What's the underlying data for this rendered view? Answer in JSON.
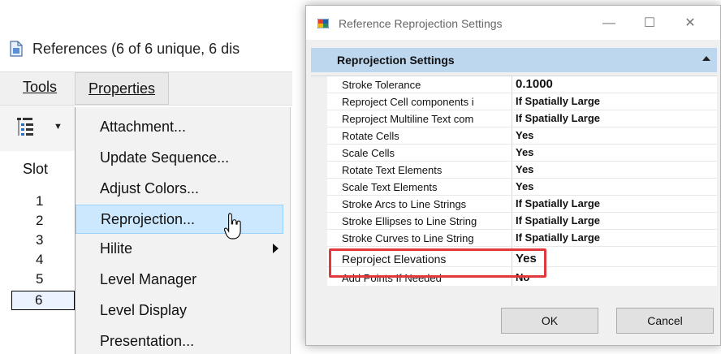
{
  "left_window": {
    "title": "References (6 of 6 unique, 6 dis",
    "menubar": {
      "tools_label": "Tools",
      "properties_label": "Properties"
    },
    "slot": {
      "header": "Slot",
      "rows": [
        "1",
        "2",
        "3",
        "4",
        "5",
        "6"
      ],
      "selected": "6"
    },
    "properties_menu": {
      "items": [
        {
          "label": "Attachment..."
        },
        {
          "label": "Update Sequence..."
        },
        {
          "label": "Adjust Colors..."
        },
        {
          "label": "Reprojection...",
          "highlighted": true
        },
        {
          "label": "Hilite",
          "has_submenu": true
        },
        {
          "label": "Level Manager"
        },
        {
          "label": "Level Display"
        },
        {
          "label": "Presentation..."
        }
      ]
    }
  },
  "dialog": {
    "title": "Reference Reprojection Settings",
    "window_buttons": {
      "minimize": "—",
      "maximize": "☐",
      "close": "✕"
    },
    "section_title": "Reprojection Settings",
    "properties": [
      {
        "key": "Stroke Tolerance",
        "value": "0.1000"
      },
      {
        "key": "Reproject Cell components i",
        "value": "If Spatially Large"
      },
      {
        "key": "Reproject Multiline Text com",
        "value": "If Spatially Large"
      },
      {
        "key": "Rotate Cells",
        "value": "Yes"
      },
      {
        "key": "Scale Cells",
        "value": "Yes"
      },
      {
        "key": "Rotate Text Elements",
        "value": "Yes"
      },
      {
        "key": "Scale Text Elements",
        "value": "Yes"
      },
      {
        "key": "Stroke Arcs to Line Strings",
        "value": "If Spatially Large"
      },
      {
        "key": "Stroke Ellipses to Line String",
        "value": "If Spatially Large"
      },
      {
        "key": "Stroke Curves to Line String",
        "value": "If Spatially Large"
      },
      {
        "key": "Reproject Elevations",
        "value": "Yes",
        "highlighted": true
      },
      {
        "key": "Add Points If Needed",
        "value": "No"
      }
    ],
    "ok_label": "OK",
    "cancel_label": "Cancel"
  },
  "colors": {
    "highlight_box": "#e0393b",
    "menu_highlight": "#cce8ff",
    "section_bar": "#bdd7ef"
  }
}
